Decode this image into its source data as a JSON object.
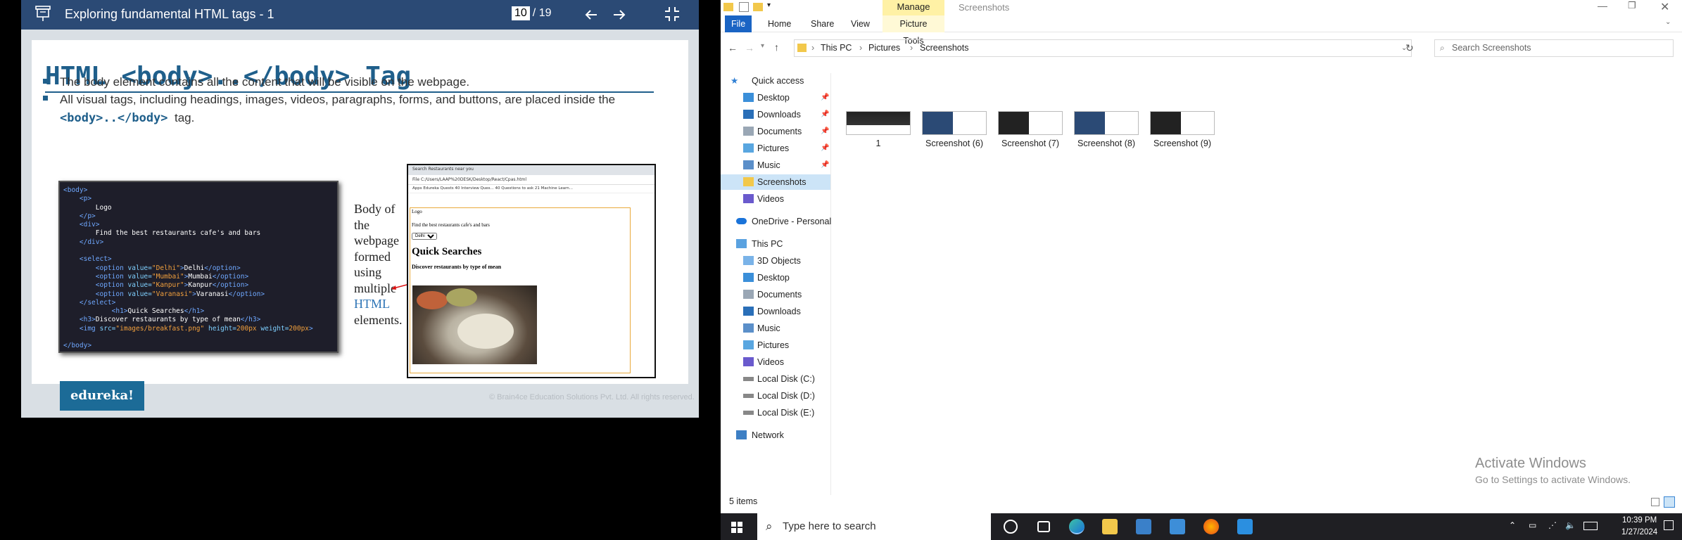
{
  "viewer": {
    "title": "Exploring fundamental HTML tags - 1",
    "page_current": "10",
    "page_total": "/ 19",
    "slide_title": "HTML <body>..</body> Tag",
    "bullet1": "The body element contains all the content that will be visible on the webpage.",
    "bullet2": "All visual tags, including headings, images, videos, paragraphs, forms, and buttons, are placed inside the",
    "bullet2_code": "<body>..</body>",
    "bullet2_tail": "tag.",
    "body_text": [
      "Body of the webpage formed using multiple",
      "HTML",
      "elements."
    ],
    "brand": "edureka!",
    "copyright": "© Brain4ce Education Solutions Pvt. Ltd. All rights reserved.",
    "browser": {
      "tab": "Search Restaurants near you",
      "address": "File   C:/Users/LAAP%20DESK/Desktop/React/Cpas.html",
      "bookmarks": "Apps   Edureka Quests   40 Interview Ques...   40 Questions to ask   21 Machine Learn...",
      "logo": "Logo",
      "find": "Find the best restaurants cafe's and bars",
      "select": "Delhi",
      "h2": "Quick Searches",
      "h3": "Discover restaurants by type of mean"
    }
  },
  "explorer": {
    "window_title": "Screenshots",
    "manage": "Manage",
    "tabs": [
      "File",
      "Home",
      "Share",
      "View",
      "Picture Tools"
    ],
    "breadcrumb": [
      "This PC",
      "Pictures",
      "Screenshots"
    ],
    "search_placeholder": "Search Screenshots",
    "nav": {
      "quick_access": "Quick access",
      "qa_items": [
        "Desktop",
        "Downloads",
        "Documents",
        "Pictures",
        "Music",
        "Screenshots",
        "Videos"
      ],
      "onedrive": "OneDrive - Personal",
      "this_pc": "This PC",
      "pc_items": [
        "3D Objects",
        "Desktop",
        "Documents",
        "Downloads",
        "Music",
        "Pictures",
        "Videos",
        "Local Disk (C:)",
        "Local Disk (D:)",
        "Local Disk (E:)"
      ],
      "network": "Network"
    },
    "files": [
      "1",
      "Screenshot (6)",
      "Screenshot (7)",
      "Screenshot (8)",
      "Screenshot (9)"
    ],
    "status": "5 items",
    "activate_title": "Activate Windows",
    "activate_sub": "Go to Settings to activate Windows."
  },
  "taskbar": {
    "search_placeholder": "Type here to search",
    "time": "10:39 PM",
    "date": "1/27/2024"
  }
}
